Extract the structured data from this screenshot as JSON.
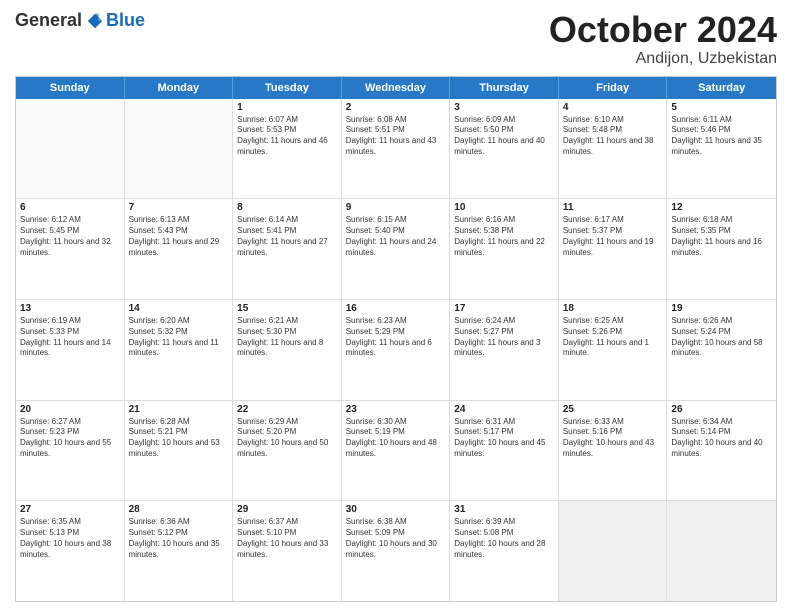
{
  "header": {
    "logo_general": "General",
    "logo_blue": "Blue",
    "month_title": "October 2024",
    "location": "Andijon, Uzbekistan"
  },
  "calendar": {
    "days_of_week": [
      "Sunday",
      "Monday",
      "Tuesday",
      "Wednesday",
      "Thursday",
      "Friday",
      "Saturday"
    ],
    "weeks": [
      [
        {
          "day": "",
          "sunrise": "",
          "sunset": "",
          "daylight": "",
          "empty": true
        },
        {
          "day": "",
          "sunrise": "",
          "sunset": "",
          "daylight": "",
          "empty": true
        },
        {
          "day": "1",
          "sunrise": "Sunrise: 6:07 AM",
          "sunset": "Sunset: 5:53 PM",
          "daylight": "Daylight: 11 hours and 46 minutes.",
          "empty": false
        },
        {
          "day": "2",
          "sunrise": "Sunrise: 6:08 AM",
          "sunset": "Sunset: 5:51 PM",
          "daylight": "Daylight: 11 hours and 43 minutes.",
          "empty": false
        },
        {
          "day": "3",
          "sunrise": "Sunrise: 6:09 AM",
          "sunset": "Sunset: 5:50 PM",
          "daylight": "Daylight: 11 hours and 40 minutes.",
          "empty": false
        },
        {
          "day": "4",
          "sunrise": "Sunrise: 6:10 AM",
          "sunset": "Sunset: 5:48 PM",
          "daylight": "Daylight: 11 hours and 38 minutes.",
          "empty": false
        },
        {
          "day": "5",
          "sunrise": "Sunrise: 6:11 AM",
          "sunset": "Sunset: 5:46 PM",
          "daylight": "Daylight: 11 hours and 35 minutes.",
          "empty": false
        }
      ],
      [
        {
          "day": "6",
          "sunrise": "Sunrise: 6:12 AM",
          "sunset": "Sunset: 5:45 PM",
          "daylight": "Daylight: 11 hours and 32 minutes.",
          "empty": false
        },
        {
          "day": "7",
          "sunrise": "Sunrise: 6:13 AM",
          "sunset": "Sunset: 5:43 PM",
          "daylight": "Daylight: 11 hours and 29 minutes.",
          "empty": false
        },
        {
          "day": "8",
          "sunrise": "Sunrise: 6:14 AM",
          "sunset": "Sunset: 5:41 PM",
          "daylight": "Daylight: 11 hours and 27 minutes.",
          "empty": false
        },
        {
          "day": "9",
          "sunrise": "Sunrise: 6:15 AM",
          "sunset": "Sunset: 5:40 PM",
          "daylight": "Daylight: 11 hours and 24 minutes.",
          "empty": false
        },
        {
          "day": "10",
          "sunrise": "Sunrise: 6:16 AM",
          "sunset": "Sunset: 5:38 PM",
          "daylight": "Daylight: 11 hours and 22 minutes.",
          "empty": false
        },
        {
          "day": "11",
          "sunrise": "Sunrise: 6:17 AM",
          "sunset": "Sunset: 5:37 PM",
          "daylight": "Daylight: 11 hours and 19 minutes.",
          "empty": false
        },
        {
          "day": "12",
          "sunrise": "Sunrise: 6:18 AM",
          "sunset": "Sunset: 5:35 PM",
          "daylight": "Daylight: 11 hours and 16 minutes.",
          "empty": false
        }
      ],
      [
        {
          "day": "13",
          "sunrise": "Sunrise: 6:19 AM",
          "sunset": "Sunset: 5:33 PM",
          "daylight": "Daylight: 11 hours and 14 minutes.",
          "empty": false
        },
        {
          "day": "14",
          "sunrise": "Sunrise: 6:20 AM",
          "sunset": "Sunset: 5:32 PM",
          "daylight": "Daylight: 11 hours and 11 minutes.",
          "empty": false
        },
        {
          "day": "15",
          "sunrise": "Sunrise: 6:21 AM",
          "sunset": "Sunset: 5:30 PM",
          "daylight": "Daylight: 11 hours and 8 minutes.",
          "empty": false
        },
        {
          "day": "16",
          "sunrise": "Sunrise: 6:23 AM",
          "sunset": "Sunset: 5:29 PM",
          "daylight": "Daylight: 11 hours and 6 minutes.",
          "empty": false
        },
        {
          "day": "17",
          "sunrise": "Sunrise: 6:24 AM",
          "sunset": "Sunset: 5:27 PM",
          "daylight": "Daylight: 11 hours and 3 minutes.",
          "empty": false
        },
        {
          "day": "18",
          "sunrise": "Sunrise: 6:25 AM",
          "sunset": "Sunset: 5:26 PM",
          "daylight": "Daylight: 11 hours and 1 minute.",
          "empty": false
        },
        {
          "day": "19",
          "sunrise": "Sunrise: 6:26 AM",
          "sunset": "Sunset: 5:24 PM",
          "daylight": "Daylight: 10 hours and 58 minutes.",
          "empty": false
        }
      ],
      [
        {
          "day": "20",
          "sunrise": "Sunrise: 6:27 AM",
          "sunset": "Sunset: 5:23 PM",
          "daylight": "Daylight: 10 hours and 55 minutes.",
          "empty": false
        },
        {
          "day": "21",
          "sunrise": "Sunrise: 6:28 AM",
          "sunset": "Sunset: 5:21 PM",
          "daylight": "Daylight: 10 hours and 53 minutes.",
          "empty": false
        },
        {
          "day": "22",
          "sunrise": "Sunrise: 6:29 AM",
          "sunset": "Sunset: 5:20 PM",
          "daylight": "Daylight: 10 hours and 50 minutes.",
          "empty": false
        },
        {
          "day": "23",
          "sunrise": "Sunrise: 6:30 AM",
          "sunset": "Sunset: 5:19 PM",
          "daylight": "Daylight: 10 hours and 48 minutes.",
          "empty": false
        },
        {
          "day": "24",
          "sunrise": "Sunrise: 6:31 AM",
          "sunset": "Sunset: 5:17 PM",
          "daylight": "Daylight: 10 hours and 45 minutes.",
          "empty": false
        },
        {
          "day": "25",
          "sunrise": "Sunrise: 6:33 AM",
          "sunset": "Sunset: 5:16 PM",
          "daylight": "Daylight: 10 hours and 43 minutes.",
          "empty": false
        },
        {
          "day": "26",
          "sunrise": "Sunrise: 6:34 AM",
          "sunset": "Sunset: 5:14 PM",
          "daylight": "Daylight: 10 hours and 40 minutes.",
          "empty": false
        }
      ],
      [
        {
          "day": "27",
          "sunrise": "Sunrise: 6:35 AM",
          "sunset": "Sunset: 5:13 PM",
          "daylight": "Daylight: 10 hours and 38 minutes.",
          "empty": false
        },
        {
          "day": "28",
          "sunrise": "Sunrise: 6:36 AM",
          "sunset": "Sunset: 5:12 PM",
          "daylight": "Daylight: 10 hours and 35 minutes.",
          "empty": false
        },
        {
          "day": "29",
          "sunrise": "Sunrise: 6:37 AM",
          "sunset": "Sunset: 5:10 PM",
          "daylight": "Daylight: 10 hours and 33 minutes.",
          "empty": false
        },
        {
          "day": "30",
          "sunrise": "Sunrise: 6:38 AM",
          "sunset": "Sunset: 5:09 PM",
          "daylight": "Daylight: 10 hours and 30 minutes.",
          "empty": false
        },
        {
          "day": "31",
          "sunrise": "Sunrise: 6:39 AM",
          "sunset": "Sunset: 5:08 PM",
          "daylight": "Daylight: 10 hours and 28 minutes.",
          "empty": false
        },
        {
          "day": "",
          "sunrise": "",
          "sunset": "",
          "daylight": "",
          "empty": true
        },
        {
          "day": "",
          "sunrise": "",
          "sunset": "",
          "daylight": "",
          "empty": true
        }
      ]
    ]
  }
}
